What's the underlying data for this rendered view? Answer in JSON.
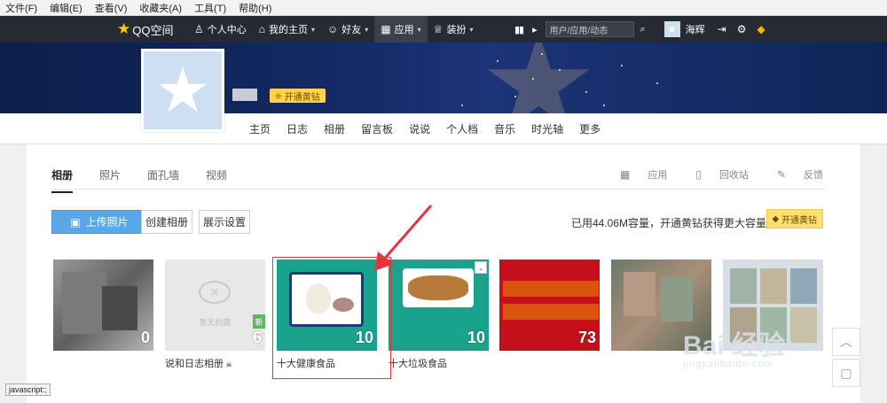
{
  "menubar": {
    "items": [
      "文件(F)",
      "编辑(E)",
      "查看(V)",
      "收藏夹(A)",
      "工具(T)",
      "帮助(H)"
    ]
  },
  "topnav": {
    "logo": "QQ空间",
    "items": [
      {
        "label": "个人中心",
        "icon": "person-icon",
        "caret": false
      },
      {
        "label": "我的主页",
        "icon": "home-icon",
        "caret": true
      },
      {
        "label": "好友",
        "icon": "friends-icon",
        "caret": true
      },
      {
        "label": "应用",
        "icon": "apps-grid-icon",
        "caret": true
      },
      {
        "label": "装扮",
        "icon": "shirt-icon",
        "caret": true
      }
    ],
    "search_placeholder": "用户/应用/动态",
    "username": "海辉"
  },
  "profile": {
    "badge": "开通黄钻",
    "nav": [
      "主页",
      "日志",
      "相册",
      "留言板",
      "说说",
      "个人档",
      "音乐",
      "时光轴",
      "更多"
    ]
  },
  "tabs": [
    "相册",
    "照片",
    "面孔墙",
    "视频"
  ],
  "tabtools": [
    "应用",
    "回收站",
    "反馈"
  ],
  "actions": {
    "upload": "上传照片",
    "create": "创建相册",
    "display": "展示设置",
    "capacity": "已用44.06M容量，开通黄钻获得更大容量",
    "vip": "开通黄钻"
  },
  "albums": [
    {
      "name": "",
      "count": "0"
    },
    {
      "name": "说和日志相册",
      "count": "6",
      "overlay": "暂无封面",
      "badge": "新"
    },
    {
      "name": "十大健康食品",
      "count": "10"
    },
    {
      "name": "十大垃圾食品",
      "count": "10"
    },
    {
      "name": "",
      "count": "73"
    },
    {
      "name": "",
      "count": ""
    },
    {
      "name": "",
      "count": ""
    }
  ],
  "statusbar": "javascript:;",
  "watermark": {
    "main": "Bai 经验",
    "sub": "jingyanbaidu.com"
  }
}
